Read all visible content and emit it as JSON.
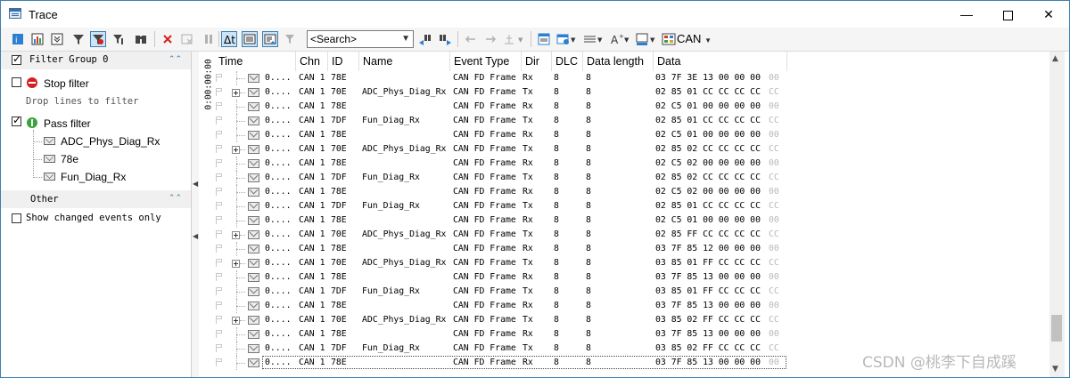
{
  "window": {
    "title": "Trace"
  },
  "toolbar": {
    "search_placeholder": "<Search>",
    "bus_label": "CAN"
  },
  "left_panel": {
    "filter_group": "Filter Group 0",
    "stop_filter": "Stop filter",
    "drop_hint": "Drop lines to filter",
    "pass_filter": "Pass filter",
    "pass_items": [
      "ADC_Phys_Diag_Rx",
      "78e",
      "Fun_Diag_Rx"
    ],
    "other_group": "Other",
    "show_changed": "Show changed events only"
  },
  "grid": {
    "time_axis_label": "0:00:00:00",
    "columns": [
      "Time",
      "Chn",
      "ID",
      "Name",
      "Event Type",
      "Dir",
      "DLC",
      "Data length",
      "Data"
    ],
    "rows": [
      {
        "time": "0....",
        "chn": "CAN 1",
        "id": "78E",
        "name": "",
        "type": "CAN FD Frame",
        "dir": "Rx",
        "dlc": "8",
        "len": "8",
        "data": "03 7F 3E 13 00 00 00",
        "last": "00",
        "exp": false
      },
      {
        "time": "0....",
        "chn": "CAN 1",
        "id": "70E",
        "name": "ADC_Phys_Diag_Rx",
        "type": "CAN FD Frame",
        "dir": "Tx",
        "dlc": "8",
        "len": "8",
        "data": "02 85 01 CC CC CC CC",
        "last": "CC",
        "exp": true
      },
      {
        "time": "0....",
        "chn": "CAN 1",
        "id": "78E",
        "name": "",
        "type": "CAN FD Frame",
        "dir": "Rx",
        "dlc": "8",
        "len": "8",
        "data": "02 C5 01 00 00 00 00",
        "last": "00",
        "exp": false
      },
      {
        "time": "0....",
        "chn": "CAN 1",
        "id": "7DF",
        "name": "Fun_Diag_Rx",
        "type": "CAN FD Frame",
        "dir": "Tx",
        "dlc": "8",
        "len": "8",
        "data": "02 85 01 CC CC CC CC",
        "last": "CC",
        "exp": false
      },
      {
        "time": "0....",
        "chn": "CAN 1",
        "id": "78E",
        "name": "",
        "type": "CAN FD Frame",
        "dir": "Rx",
        "dlc": "8",
        "len": "8",
        "data": "02 C5 01 00 00 00 00",
        "last": "00",
        "exp": false
      },
      {
        "time": "0....",
        "chn": "CAN 1",
        "id": "70E",
        "name": "ADC_Phys_Diag_Rx",
        "type": "CAN FD Frame",
        "dir": "Tx",
        "dlc": "8",
        "len": "8",
        "data": "02 85 02 CC CC CC CC",
        "last": "CC",
        "exp": true
      },
      {
        "time": "0....",
        "chn": "CAN 1",
        "id": "78E",
        "name": "",
        "type": "CAN FD Frame",
        "dir": "Rx",
        "dlc": "8",
        "len": "8",
        "data": "02 C5 02 00 00 00 00",
        "last": "00",
        "exp": false
      },
      {
        "time": "0....",
        "chn": "CAN 1",
        "id": "7DF",
        "name": "Fun_Diag_Rx",
        "type": "CAN FD Frame",
        "dir": "Tx",
        "dlc": "8",
        "len": "8",
        "data": "02 85 02 CC CC CC CC",
        "last": "CC",
        "exp": false
      },
      {
        "time": "0....",
        "chn": "CAN 1",
        "id": "78E",
        "name": "",
        "type": "CAN FD Frame",
        "dir": "Rx",
        "dlc": "8",
        "len": "8",
        "data": "02 C5 02 00 00 00 00",
        "last": "00",
        "exp": false
      },
      {
        "time": "0....",
        "chn": "CAN 1",
        "id": "7DF",
        "name": "Fun_Diag_Rx",
        "type": "CAN FD Frame",
        "dir": "Tx",
        "dlc": "8",
        "len": "8",
        "data": "02 85 01 CC CC CC CC",
        "last": "CC",
        "exp": false
      },
      {
        "time": "0....",
        "chn": "CAN 1",
        "id": "78E",
        "name": "",
        "type": "CAN FD Frame",
        "dir": "Rx",
        "dlc": "8",
        "len": "8",
        "data": "02 C5 01 00 00 00 00",
        "last": "00",
        "exp": false
      },
      {
        "time": "0....",
        "chn": "CAN 1",
        "id": "70E",
        "name": "ADC_Phys_Diag_Rx",
        "type": "CAN FD Frame",
        "dir": "Tx",
        "dlc": "8",
        "len": "8",
        "data": "02 85 FF CC CC CC CC",
        "last": "CC",
        "exp": true
      },
      {
        "time": "0....",
        "chn": "CAN 1",
        "id": "78E",
        "name": "",
        "type": "CAN FD Frame",
        "dir": "Rx",
        "dlc": "8",
        "len": "8",
        "data": "03 7F 85 12 00 00 00",
        "last": "00",
        "exp": false
      },
      {
        "time": "0....",
        "chn": "CAN 1",
        "id": "70E",
        "name": "ADC_Phys_Diag_Rx",
        "type": "CAN FD Frame",
        "dir": "Tx",
        "dlc": "8",
        "len": "8",
        "data": "03 85 01 FF CC CC CC",
        "last": "CC",
        "exp": true
      },
      {
        "time": "0....",
        "chn": "CAN 1",
        "id": "78E",
        "name": "",
        "type": "CAN FD Frame",
        "dir": "Rx",
        "dlc": "8",
        "len": "8",
        "data": "03 7F 85 13 00 00 00",
        "last": "00",
        "exp": false
      },
      {
        "time": "0....",
        "chn": "CAN 1",
        "id": "7DF",
        "name": "Fun_Diag_Rx",
        "type": "CAN FD Frame",
        "dir": "Tx",
        "dlc": "8",
        "len": "8",
        "data": "03 85 01 FF CC CC CC",
        "last": "CC",
        "exp": false
      },
      {
        "time": "0....",
        "chn": "CAN 1",
        "id": "78E",
        "name": "",
        "type": "CAN FD Frame",
        "dir": "Rx",
        "dlc": "8",
        "len": "8",
        "data": "03 7F 85 13 00 00 00",
        "last": "00",
        "exp": false
      },
      {
        "time": "0....",
        "chn": "CAN 1",
        "id": "70E",
        "name": "ADC_Phys_Diag_Rx",
        "type": "CAN FD Frame",
        "dir": "Tx",
        "dlc": "8",
        "len": "8",
        "data": "03 85 02 FF CC CC CC",
        "last": "CC",
        "exp": true
      },
      {
        "time": "0....",
        "chn": "CAN 1",
        "id": "78E",
        "name": "",
        "type": "CAN FD Frame",
        "dir": "Rx",
        "dlc": "8",
        "len": "8",
        "data": "03 7F 85 13 00 00 00",
        "last": "00",
        "exp": false
      },
      {
        "time": "0....",
        "chn": "CAN 1",
        "id": "7DF",
        "name": "Fun_Diag_Rx",
        "type": "CAN FD Frame",
        "dir": "Tx",
        "dlc": "8",
        "len": "8",
        "data": "03 85 02 FF CC CC CC",
        "last": "CC",
        "exp": false
      },
      {
        "time": "0....",
        "chn": "CAN 1",
        "id": "78E",
        "name": "",
        "type": "CAN FD Frame",
        "dir": "Rx",
        "dlc": "8",
        "len": "8",
        "data": "03 7F 85 13 00 00 00",
        "last": "00",
        "exp": false
      }
    ]
  },
  "watermark": "CSDN @桃李下自成蹊",
  "colors": {
    "accent": "#3c7fb1",
    "pressed_bg": "#cce4f7",
    "stop": "#d61f1f",
    "pass": "#3aa33a"
  }
}
